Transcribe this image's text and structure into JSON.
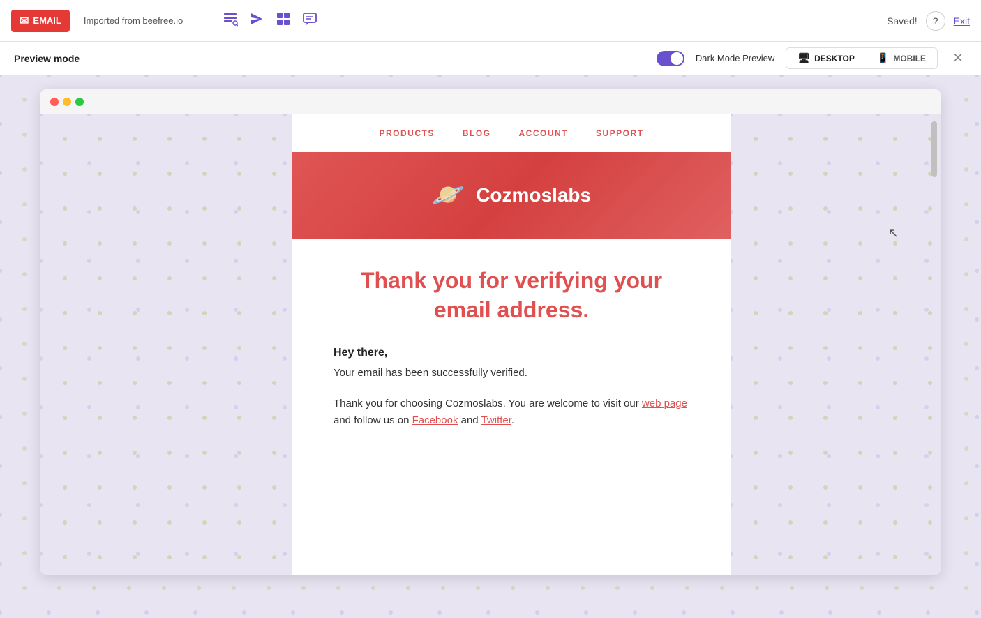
{
  "toolbar": {
    "email_badge": "EMAIL",
    "imported_from": "Imported from beefree.io",
    "saved_text": "Saved!",
    "exit_label": "Exit",
    "help_label": "?"
  },
  "preview_bar": {
    "label": "Preview mode",
    "dark_mode_label": "Dark Mode Preview",
    "desktop_label": "DESKTOP",
    "mobile_label": "MOBILE"
  },
  "email": {
    "nav": {
      "products": "PRODUCTS",
      "blog": "BLOG",
      "account": "ACCOUNT",
      "support": "SUPPORT"
    },
    "hero": {
      "brand": "Cozmoslabs"
    },
    "heading": "Thank you for verifying your email address.",
    "greeting": "Hey there,",
    "verified_text": "Your email has been successfully verified.",
    "body_text": "Thank you for choosing Cozmoslabs. You are welcome to visit our",
    "web_page_link": "web page",
    "follow_text": "and follow us on",
    "facebook_link": "Facebook",
    "and_text": "and",
    "twitter_link": "Twitter",
    "period": "."
  }
}
